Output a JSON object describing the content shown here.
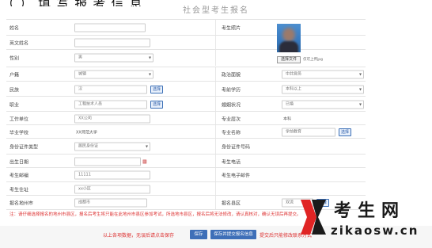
{
  "top_fragment": "（ ） 填 写 报 考 信 息",
  "form_title": "社会型考生报名",
  "rows": [
    {
      "label": "姓名",
      "value": "",
      "label2": "考生照片"
    },
    {
      "label": "英文姓名",
      "value": "",
      "label2": ""
    },
    {
      "label": "性别",
      "value": "男",
      "label2": ""
    },
    {
      "label": "户籍",
      "value": "城镇",
      "label2": "政治面貌",
      "value2": "中共党员"
    },
    {
      "label": "民族",
      "value": "汉",
      "btn": "选择",
      "label2": "考前学历",
      "value2": "本科以上"
    },
    {
      "label": "职业",
      "value": "工程技术人员",
      "btn": "选择",
      "label2": "婚姻状况",
      "value2": "已婚"
    },
    {
      "label": "工作单位",
      "value": "XX公司",
      "label2": "专业层次",
      "value2": "本科"
    },
    {
      "label": "毕业学校",
      "value": "XX师范大学",
      "label2": "专业名称",
      "value2": "学前教育",
      "btn2": "选择"
    },
    {
      "label": "身份证件类型",
      "value": "居民身份证",
      "label2": "身份证件号码",
      "value2": ""
    },
    {
      "label": "出生日期",
      "value": "",
      "label2": "考生电话",
      "value2": ""
    },
    {
      "label": "考生邮编",
      "value": "11111",
      "label2": "考生电子邮件",
      "value2": ""
    },
    {
      "label": "考生住址",
      "value": "xx小区",
      "label2": ""
    },
    {
      "label": "报名地州市",
      "value": "成都市",
      "label2": "报名县区",
      "value2": "双流",
      "btn2": "选择"
    }
  ],
  "photo": {
    "upload_button": "选择文件",
    "note": "仅可上传jpg"
  },
  "notice": "注：请仔细选择报名的地州市县区，报名后考生将只能在此地州市县区参加考试，所选地市县区，报名后将无法修改，请认真核对，确认无误后再提交。",
  "bottom": {
    "note_left": "以上各项数据，无误后请点击保存",
    "save_label": "保存",
    "save_submit_label": "保存并提交报名信息",
    "note_right": "提交后只能修改联系方式"
  },
  "watermark": {
    "title": "考生网",
    "url": "zikaosw.cn"
  },
  "colors": {
    "accent": "#3e6fb8",
    "notice": "#dd3333"
  }
}
